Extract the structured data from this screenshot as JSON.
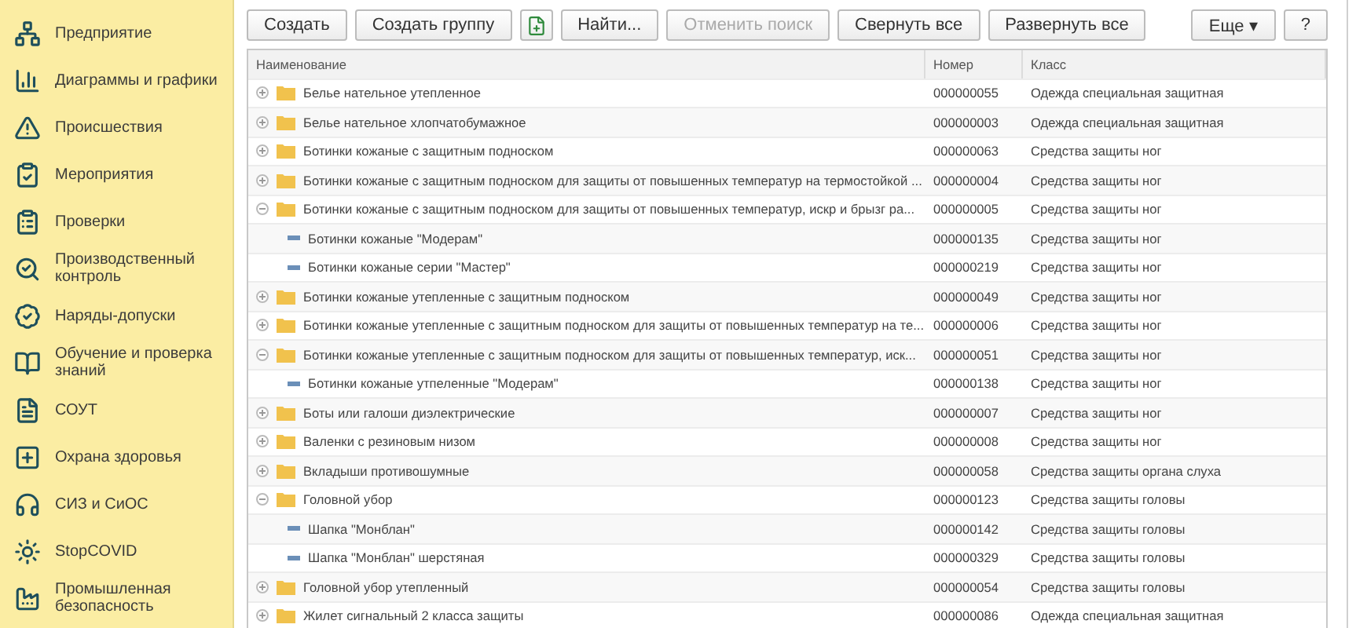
{
  "sidebar": {
    "items": [
      {
        "label": "Предприятие"
      },
      {
        "label": "Диаграммы и графики"
      },
      {
        "label": "Происшествия"
      },
      {
        "label": "Мероприятия"
      },
      {
        "label": "Проверки"
      },
      {
        "label": "Производственный контроль"
      },
      {
        "label": "Наряды-допуски"
      },
      {
        "label": "Обучение и проверка знаний"
      },
      {
        "label": "СОУТ"
      },
      {
        "label": "Охрана здоровья"
      },
      {
        "label": "СИЗ и СиОС"
      },
      {
        "label": "StopCOVID"
      },
      {
        "label": "Промышленная безопасность"
      }
    ]
  },
  "toolbar": {
    "buttons": [
      {
        "kind": "text",
        "label": "Создать",
        "disabled": false
      },
      {
        "kind": "text",
        "label": "Создать группу",
        "disabled": false
      },
      {
        "kind": "icon",
        "disabled": false
      },
      {
        "kind": "text",
        "label": "Найти...",
        "disabled": false
      },
      {
        "kind": "text",
        "label": "Отменить поиск",
        "disabled": true
      },
      {
        "kind": "text",
        "label": "Свернуть все",
        "disabled": false
      },
      {
        "kind": "text",
        "label": "Развернуть все",
        "disabled": false
      }
    ],
    "more_button": {
      "label": "Еще",
      "caret": "▾"
    },
    "help_button": {
      "label": "?"
    }
  },
  "table": {
    "columns": [
      "Наименование",
      "Номер",
      "Класс"
    ],
    "rows": [
      {
        "kind": "group",
        "expanded": false,
        "name": "Белье нательное утепленное",
        "number": "000000055",
        "class": "Одежда специальная защитная"
      },
      {
        "kind": "group",
        "expanded": false,
        "name": "Белье нательное хлопчатобумажное",
        "number": "000000003",
        "class": "Одежда специальная защитная"
      },
      {
        "kind": "group",
        "expanded": false,
        "name": "Ботинки кожаные с защитным подноском",
        "number": "000000063",
        "class": "Средства защиты ног"
      },
      {
        "kind": "group",
        "expanded": false,
        "name": "Ботинки кожаные с защитным подноском для защиты от повышенных температур на термостойкой ...",
        "number": "000000004",
        "class": "Средства защиты ног"
      },
      {
        "kind": "group",
        "expanded": true,
        "name": "Ботинки кожаные с защитным подноском для защиты от повышенных температур, искр и брызг ра...",
        "number": "000000005",
        "class": "Средства защиты ног",
        "children": [
          {
            "kind": "item",
            "name": "Ботинки кожаные \"Модерам\"",
            "number": "000000135",
            "class": "Средства защиты ног"
          },
          {
            "kind": "item",
            "name": "Ботинки кожаные серии \"Мастер\"",
            "number": "000000219",
            "class": "Средства защиты ног"
          }
        ]
      },
      {
        "kind": "group",
        "expanded": false,
        "name": "Ботинки кожаные утепленные с защитным подноском",
        "number": "000000049",
        "class": "Средства защиты ног"
      },
      {
        "kind": "group",
        "expanded": false,
        "name": "Ботинки кожаные утепленные с защитным подноском для защиты от повышенных температур на те...",
        "number": "000000006",
        "class": "Средства защиты ног"
      },
      {
        "kind": "group",
        "expanded": true,
        "name": "Ботинки кожаные утепленные с защитным подноском для защиты от повышенных температур, иск...",
        "number": "000000051",
        "class": "Средства защиты ног",
        "children": [
          {
            "kind": "item",
            "name": "Ботинки кожаные утпеленные \"Модерам\"",
            "number": "000000138",
            "class": "Средства защиты ног"
          }
        ]
      },
      {
        "kind": "group",
        "expanded": false,
        "name": "Боты или галоши диэлектрические",
        "number": "000000007",
        "class": "Средства защиты ног"
      },
      {
        "kind": "group",
        "expanded": false,
        "name": "Валенки с резиновым низом",
        "number": "000000008",
        "class": "Средства защиты ног"
      },
      {
        "kind": "group",
        "expanded": false,
        "name": "Вкладыши противошумные",
        "number": "000000058",
        "class": "Средства защиты органа слуха"
      },
      {
        "kind": "group",
        "expanded": true,
        "name": "Головной убор",
        "number": "000000123",
        "class": "Средства защиты головы",
        "children": [
          {
            "kind": "item",
            "name": "Шапка \"Монблан\"",
            "number": "000000142",
            "class": "Средства защиты головы"
          },
          {
            "kind": "item",
            "name": "Шапка \"Монблан\" шерстяная",
            "number": "000000329",
            "class": "Средства защиты головы"
          }
        ]
      },
      {
        "kind": "group",
        "expanded": false,
        "name": "Головной убор утепленный",
        "number": "000000054",
        "class": "Средства защиты головы"
      },
      {
        "kind": "group",
        "expanded": false,
        "name": "Жилет сигнальный 2 класса защиты",
        "number": "000000086",
        "class": "Одежда специальная защитная"
      }
    ]
  }
}
